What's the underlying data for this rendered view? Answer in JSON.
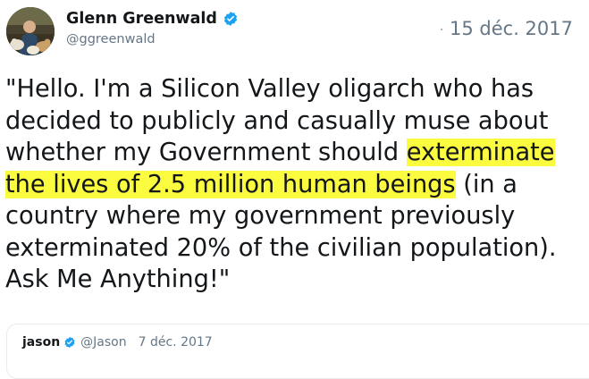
{
  "author": {
    "name": "Glenn Greenwald",
    "handle": "@ggreenwald",
    "verified_icon": "verified-badge-icon"
  },
  "tweet": {
    "date": "15 déc. 2017",
    "lines": [
      {
        "before": "\"Hello. I'm a Silicon Valley oligarch who has",
        "highlight": "",
        "after": ""
      },
      {
        "before": "decided to publicly and casually muse about",
        "highlight": "",
        "after": ""
      },
      {
        "before": "whether my Government should ",
        "highlight": "exterminate",
        "after": ""
      },
      {
        "before": "",
        "highlight": "the lives of 2.5 million human beings",
        "after": " (in a"
      },
      {
        "before": "country where my government previously",
        "highlight": "",
        "after": ""
      },
      {
        "before": "exterminated 20% of the civilian population).",
        "highlight": "",
        "after": ""
      },
      {
        "before": "Ask Me Anything!\"",
        "highlight": "",
        "after": ""
      }
    ],
    "highlight_color": "#fbfb3f"
  },
  "quoted": {
    "name": "jason",
    "handle": "@Jason",
    "date": "7 déc. 2017"
  },
  "colors": {
    "text": "#14171a",
    "secondary": "#657786",
    "verified": "#1da1f2"
  }
}
